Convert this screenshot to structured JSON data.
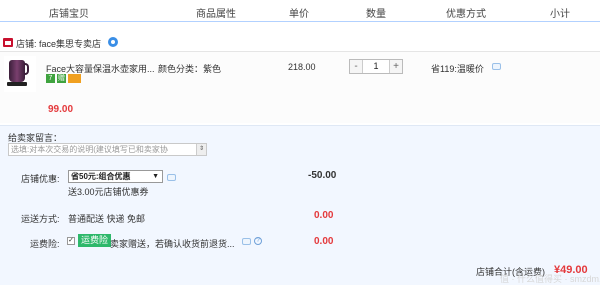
{
  "header": {
    "columns": [
      "店铺宝贝",
      "商品属性",
      "单价",
      "数量",
      "优惠方式",
      "小计"
    ]
  },
  "shop": {
    "label": "店铺: face集思专卖店",
    "icon": "shop-icon",
    "chat_icon": "wangwang-icon"
  },
  "item": {
    "title": "Face大容量保温水壶家用...",
    "attribute": "颜色分类：紫色",
    "unit_price": "218.00",
    "quantity": "1",
    "minus": "-",
    "plus": "+",
    "discount": "省119:温暖价",
    "subtotal": "99.00",
    "badges": [
      {
        "text": "7",
        "color": "#3fa33f"
      },
      {
        "text": "赠",
        "color": "#3fa33f"
      },
      {
        "text": "",
        "color": "#f0a020"
      }
    ]
  },
  "message": {
    "label": "给卖家留言：",
    "placeholder": "选填:对本次交易的说明(建议填写已和卖家协"
  },
  "shop_discount": {
    "label": "店铺优惠:",
    "selected": "省50元:组合优惠",
    "coupon_note": "送3.00元店铺优惠券",
    "amount": "-50.00"
  },
  "shipping": {
    "label": "运送方式:",
    "value": "普通配送 快递 免邮",
    "amount": "0.00"
  },
  "insurance": {
    "label": "运费险:",
    "checkbox": "✓",
    "badge": "运费险",
    "text": "卖家赠送，若确认收货前退货...",
    "amount": "0.00"
  },
  "total": {
    "label": "店铺合计(含运费)",
    "amount": "¥49.00"
  },
  "watermark": "值 · 什么值得买 · smzdm.com",
  "colors": {
    "accent": "#e4393c",
    "header_border": "#b2d1ff",
    "panel_bg": "#f2f7ff",
    "green": "#2eb86b"
  }
}
